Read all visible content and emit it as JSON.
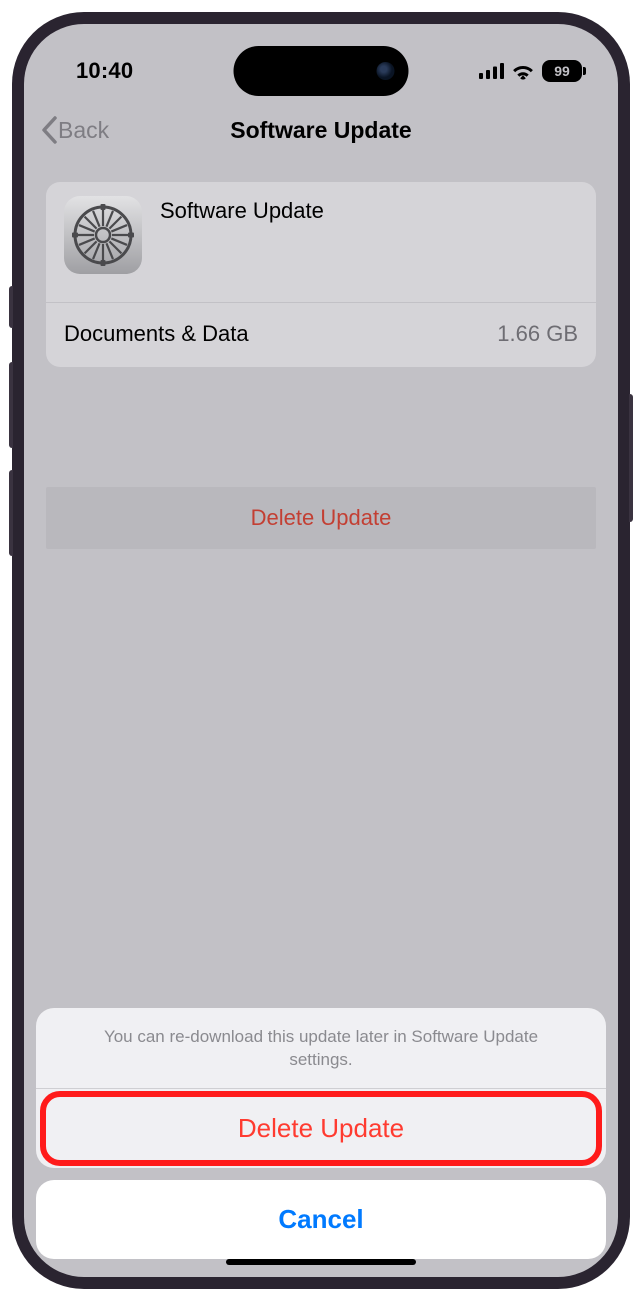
{
  "status_bar": {
    "time": "10:40",
    "battery_percent": "99"
  },
  "nav": {
    "back_label": "Back",
    "title": "Software Update"
  },
  "card": {
    "title": "Software Update",
    "doc_data_label": "Documents & Data",
    "doc_data_value": "1.66 GB"
  },
  "page_delete_label": "Delete Update",
  "sheet": {
    "message": "You can re-download this update later in Software Update settings.",
    "destructive_label": "Delete Update",
    "cancel_label": "Cancel"
  }
}
